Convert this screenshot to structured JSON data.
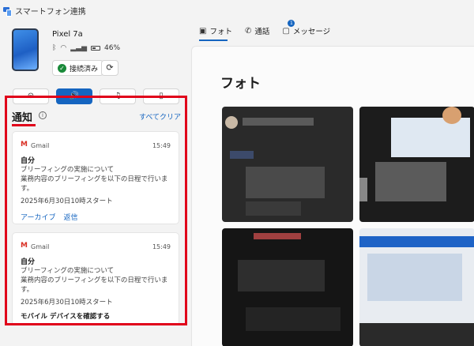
{
  "app": {
    "title": "スマートフォン連携"
  },
  "device": {
    "name": "Pixel 7a",
    "battery": "46%",
    "connected_label": "接続済み"
  },
  "quick_actions": [
    {
      "name": "do-not-disturb",
      "glyph": "⊝"
    },
    {
      "name": "sound",
      "glyph": "🔊"
    },
    {
      "name": "music",
      "glyph": "♫"
    },
    {
      "name": "phone-audio",
      "glyph": "▯"
    }
  ],
  "notifications": {
    "title": "通知",
    "clear_all": "すべてクリア",
    "items": [
      {
        "app": "Gmail",
        "time": "15:49",
        "sender": "自分",
        "lines": [
          "ブリーフィングの実施について",
          "業務内容のブリーフィングを以下の日程で行いま",
          "す。"
        ],
        "date": "2025年6月30日10時スタート",
        "actions": [
          "アーカイブ",
          "返信"
        ]
      },
      {
        "app": "Gmail",
        "time": "15:49",
        "sender": "自分",
        "lines": [
          "ブリーフィングの実施について",
          "業務内容のブリーフィングを以下の日程で行いま",
          "す。"
        ],
        "date": "2025年6月30日10時スタート",
        "action_strong": "モバイル デバイスを確認する"
      }
    ]
  },
  "tabs": [
    {
      "label": "フォト",
      "icon": "photo-icon"
    },
    {
      "label": "通話",
      "icon": "phone-icon"
    },
    {
      "label": "メッセージ",
      "icon": "message-icon",
      "badge": "1"
    }
  ],
  "photos": {
    "title": "フォト"
  },
  "colors": {
    "accent": "#1565c0",
    "highlight_border": "#e0001a"
  }
}
